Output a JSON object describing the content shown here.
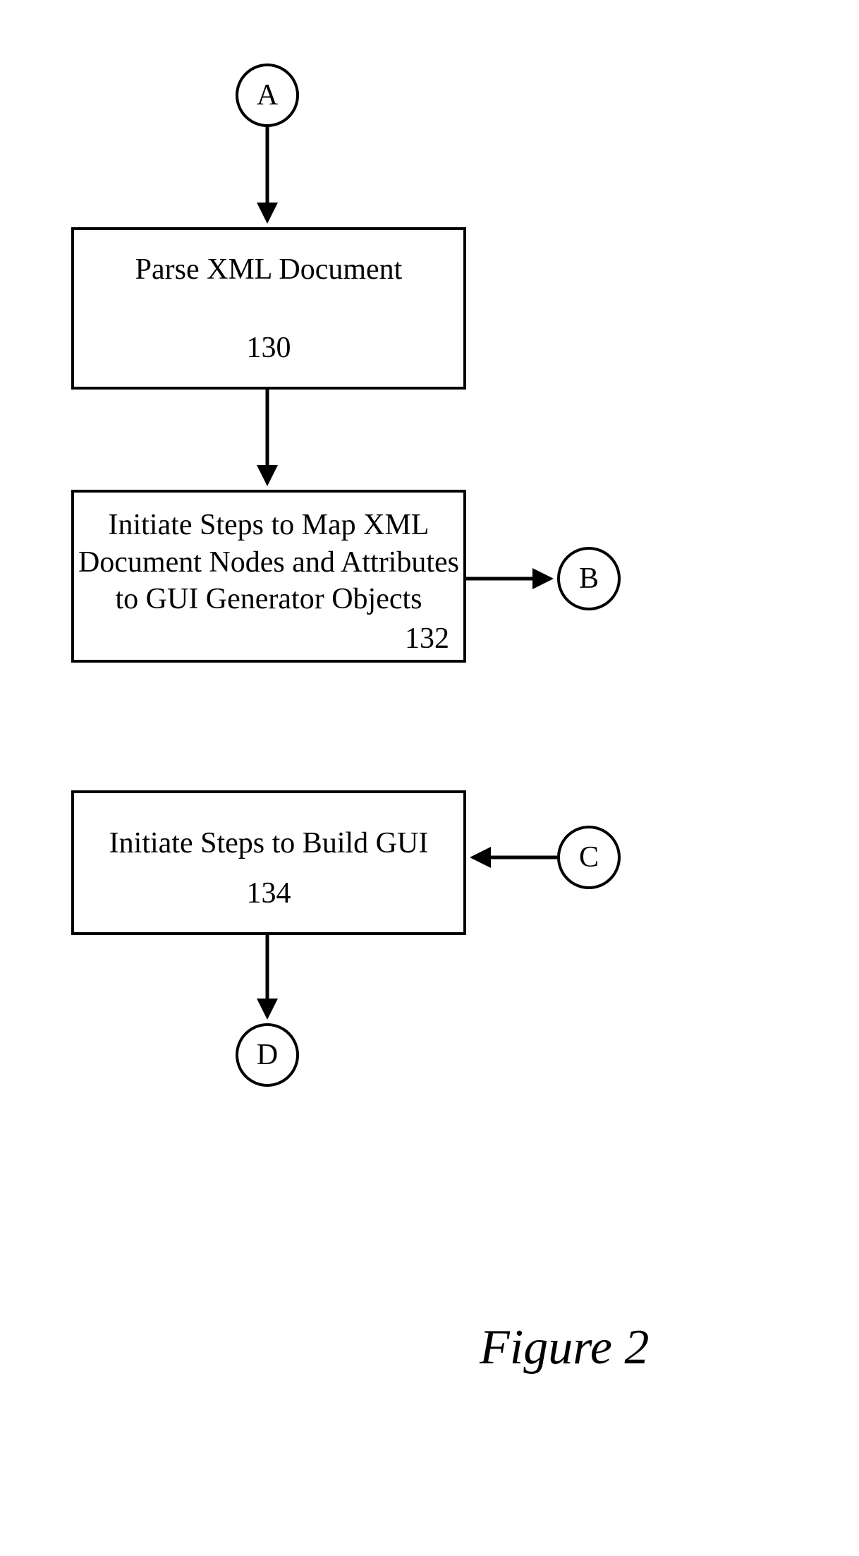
{
  "connectors": {
    "A": "A",
    "B": "B",
    "C": "C",
    "D": "D"
  },
  "boxes": {
    "parse": {
      "text": "Parse XML Document",
      "num": "130"
    },
    "map": {
      "text_line1": "Initiate Steps to Map XML",
      "text_line2": "Document Nodes and Attributes",
      "text_line3": "to GUI Generator Objects",
      "num": "132"
    },
    "build": {
      "text": "Initiate Steps to Build GUI",
      "num": "134"
    }
  },
  "caption": "Figure 2"
}
